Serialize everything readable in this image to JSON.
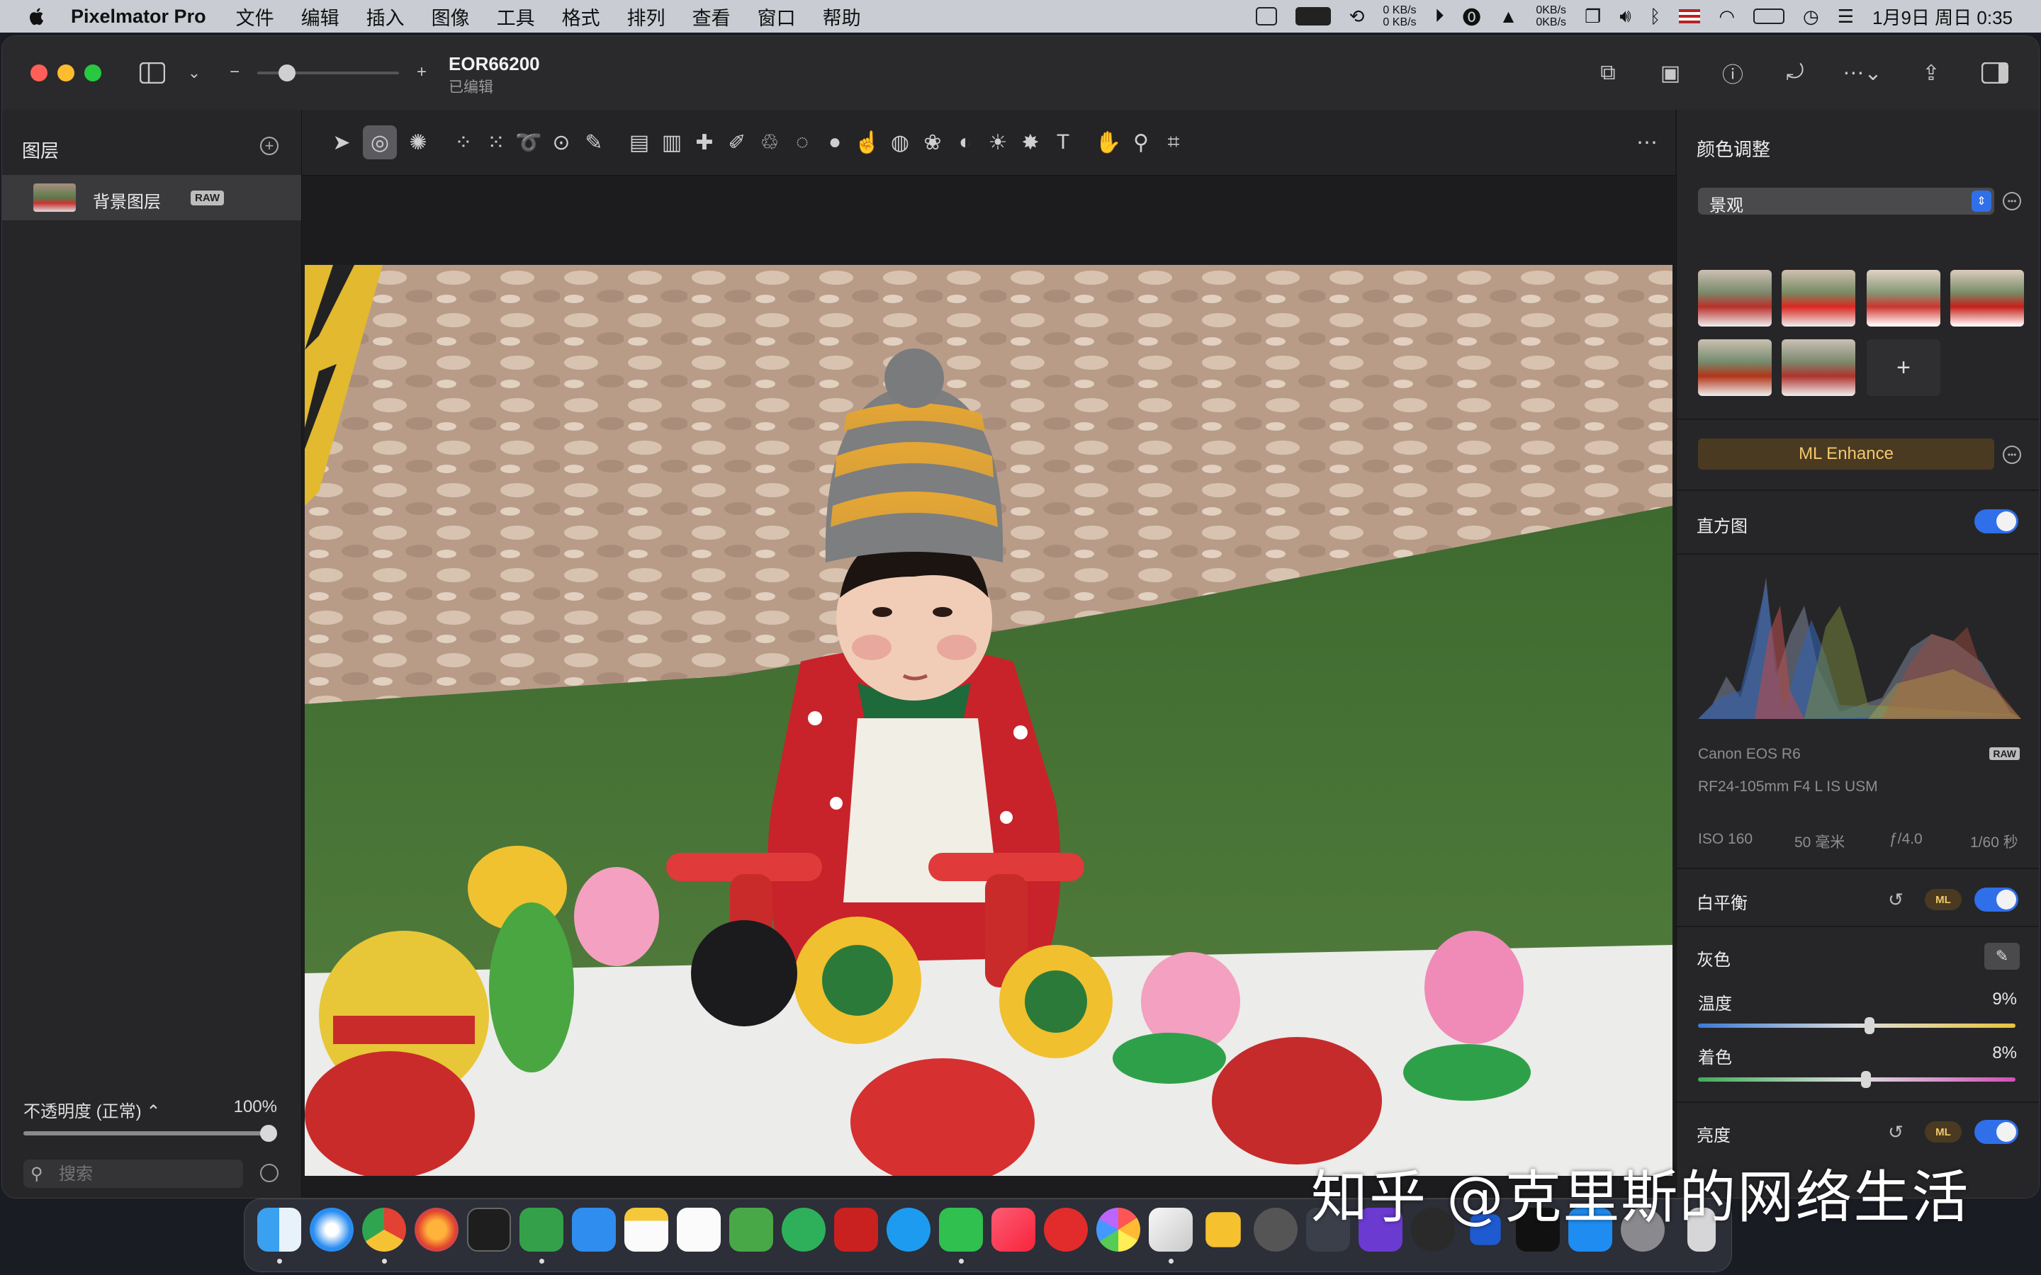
{
  "menubar": {
    "app_name": "Pixelmator Pro",
    "items": [
      "文件",
      "编辑",
      "插入",
      "图像",
      "工具",
      "格式",
      "排列",
      "查看",
      "窗口",
      "帮助"
    ],
    "net_up": "0 KB/s",
    "net_down": "0 KB/s",
    "net2_up": "0KB/s",
    "net2_down": "0KB/s",
    "datetime": "1月9日 周日 0:35"
  },
  "window": {
    "title": "EOR66200",
    "subtitle": "已编辑"
  },
  "layers": {
    "header": "图层",
    "items": [
      {
        "name": "背景图层",
        "badge": "RAW"
      }
    ],
    "opacity_label": "不透明度 (正常) ⌃",
    "opacity_value": "100%",
    "search_placeholder": "搜索"
  },
  "adjustments": {
    "header": "颜色调整",
    "preset_selected": "景观",
    "ml_enhance_label": "ML Enhance",
    "histogram_label": "直方图",
    "camera": "Canon EOS R6",
    "raw_badge": "RAW",
    "lens": "RF24-105mm F4 L IS USM",
    "iso": "ISO 160",
    "focal": "50 毫米",
    "aperture": "ƒ/4.0",
    "shutter": "1/60 秒",
    "white_balance_label": "白平衡",
    "ml_badge": "ML",
    "gray_label": "灰色",
    "temperature_label": "温度",
    "temperature_value": "9%",
    "tint_label": "着色",
    "tint_value": "8%",
    "brightness_label": "亮度",
    "temperature_level": 0.54,
    "tint_level": 0.53
  },
  "watermark": "知乎 @克里斯的网络生活",
  "colors": {
    "accent": "#2f6fea",
    "ml_gold": "#f3c86b",
    "panel": "#262628"
  }
}
